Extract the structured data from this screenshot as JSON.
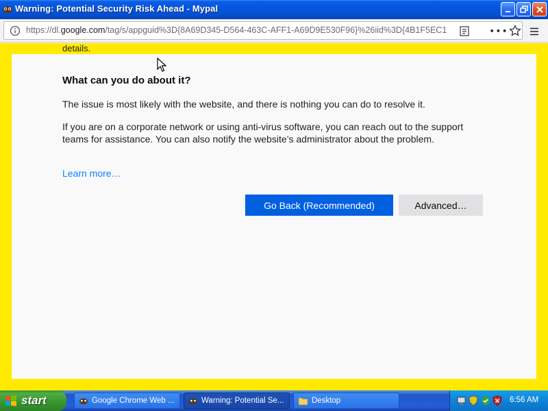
{
  "window": {
    "title": "Warning: Potential Security Risk Ahead - Mypal"
  },
  "navbar": {
    "url_prefix": "https://dl.",
    "url_host": "google.com",
    "url_rest": "/tag/s/appguid%3D{8A69D345-D564-463C-AFF1-A69D9E530F96}%26iid%3D{4B1F5EC1",
    "dots": "•••"
  },
  "page": {
    "details_fragment": "details.",
    "heading": "What can you do about it?",
    "para1": "The issue is most likely with the website, and there is nothing you can do to resolve it.",
    "para2": "If you are on a corporate network or using anti-virus software, you can reach out to the support teams for assistance. You can also notify the website’s administrator about the problem.",
    "learn_more": "Learn more…",
    "go_back": "Go Back (Recommended)",
    "advanced": "Advanced…"
  },
  "taskbar": {
    "start": "start",
    "tasks": [
      {
        "label": "Google Chrome Web ..."
      },
      {
        "label": "Warning: Potential Se..."
      },
      {
        "label": "Desktop"
      }
    ],
    "clock": "6:56 AM"
  },
  "colors": {
    "frame": "#ffea00",
    "primary_button": "#0060df",
    "link": "#0a84ff"
  }
}
